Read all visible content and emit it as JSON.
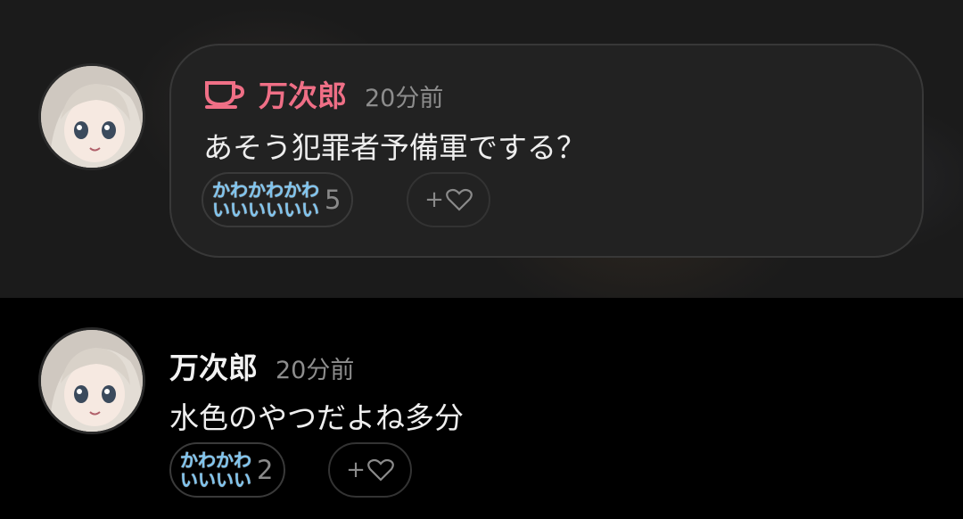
{
  "top_post": {
    "author": "万次郎",
    "time": "20分前",
    "text": "あそう犯罪者予備軍でする？",
    "reaction": {
      "line1": "かわかわかわ",
      "line2": "いいいいいい",
      "count": "5"
    },
    "add_reaction_label": "+"
  },
  "bottom_post": {
    "author": "万次郎",
    "time": "20分前",
    "text": "水色のやつだよね多分",
    "reaction": {
      "line1": "かわかわ",
      "line2": "いいいい",
      "count": "2"
    },
    "add_reaction_label": "+"
  },
  "colors": {
    "accent_name": "#ef6f86",
    "reaction_text": "#7fc4ee"
  },
  "icons": [
    "coffee-cup-icon",
    "heart-outline-icon"
  ]
}
